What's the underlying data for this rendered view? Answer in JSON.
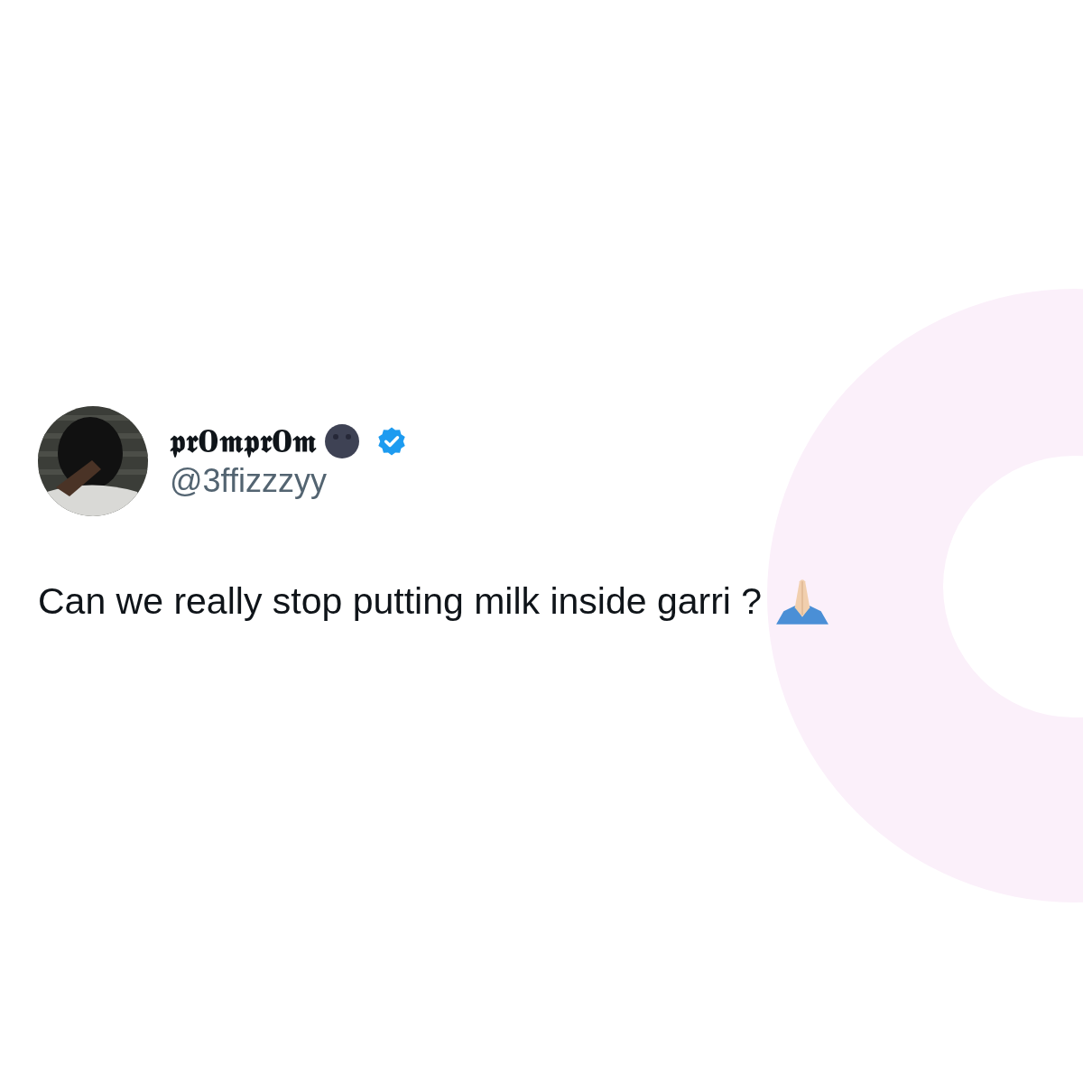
{
  "tweet": {
    "display_name": "𝖕𝖗𝟎𝖒𝖕𝖗𝟎𝖒",
    "verified": true,
    "handle": "@3ffizzzyy",
    "text": "Can we really stop putting milk inside garri ?"
  }
}
